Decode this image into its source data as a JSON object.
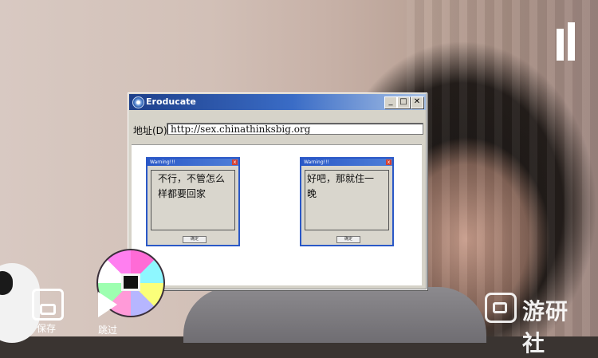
{
  "window": {
    "title": "Eroducate",
    "minimize": "_",
    "maximize": "□",
    "close": "✕",
    "address_label": "地址(D)",
    "address_value": "http://sex.chinathinksbig.org"
  },
  "dialogs": [
    {
      "title": "Warning!!!",
      "close": "x",
      "text": "不行，不管怎么样都要回家",
      "ok": "确定"
    },
    {
      "title": "Warning!!!",
      "close": "x",
      "text": "好吧，那就住一晚",
      "ok": "确定"
    }
  ],
  "controls": {
    "save_label": "保存",
    "skip_label": "跳过"
  },
  "logo": {
    "text": "游研社"
  },
  "icons": {
    "pause": "pause-icon",
    "save": "save-icon",
    "skip": "play-icon",
    "disc": "cd-icon"
  }
}
